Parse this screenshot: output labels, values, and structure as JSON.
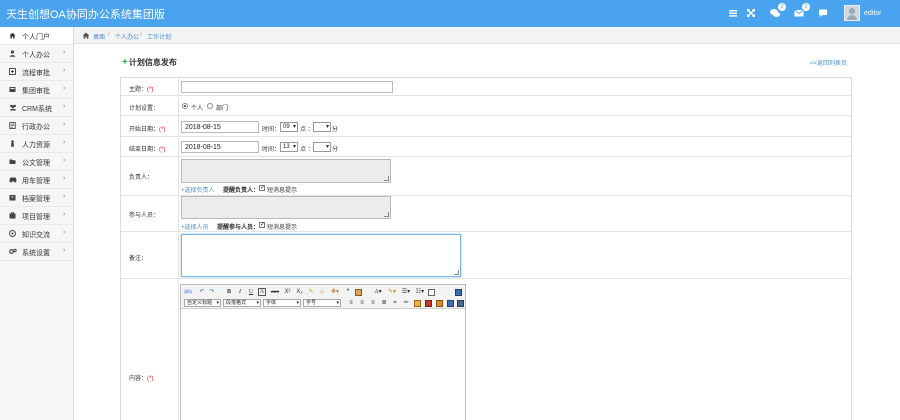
{
  "app": {
    "title": "天生创想OA协同办公系统集团版",
    "username": "editor",
    "badges": {
      "messages": "0",
      "mail": "0"
    },
    "icons": [
      "menu-icon",
      "expand-icon",
      "message-icon",
      "mail-icon",
      "chat-icon",
      "avatar"
    ]
  },
  "sidebar": {
    "items": [
      {
        "label": "个人门户",
        "icon": "home-icon",
        "active": true
      },
      {
        "label": "个人办公",
        "icon": "user-icon"
      },
      {
        "label": "流程审批",
        "icon": "flow-icon"
      },
      {
        "label": "集团审批",
        "icon": "group-icon"
      },
      {
        "label": "CRM系统",
        "icon": "users-icon"
      },
      {
        "label": "行政办公",
        "icon": "admin-icon"
      },
      {
        "label": "人力资源",
        "icon": "person-icon"
      },
      {
        "label": "公文管理",
        "icon": "folder-icon"
      },
      {
        "label": "用车管理",
        "icon": "car-icon"
      },
      {
        "label": "档案管理",
        "icon": "archive-icon"
      },
      {
        "label": "项目管理",
        "icon": "project-icon"
      },
      {
        "label": "知识交流",
        "icon": "knowledge-icon"
      },
      {
        "label": "系统设置",
        "icon": "gears-icon"
      }
    ]
  },
  "breadcrumb": {
    "home": "桌面",
    "level1": "个人办公",
    "level2": "工作计划",
    "separator": "/"
  },
  "page": {
    "title": "计划信息发布",
    "back_link": "<<返回列表页"
  },
  "form": {
    "required_mark": "(*)",
    "subject": {
      "label": "主题：",
      "value": ""
    },
    "plan_setting": {
      "label": "计划设置：",
      "options": [
        "个人",
        "部门"
      ],
      "selected": "个人"
    },
    "start_date": {
      "label": "开始日期：",
      "date": "2018-08-15",
      "time_label": "时间：",
      "hour": "09",
      "hour_unit": "点 ：",
      "minute": "",
      "minute_unit": "分"
    },
    "end_date": {
      "label": "结束日期：",
      "date": "2018-08-15",
      "time_label": "时间：",
      "hour": "13",
      "hour_unit": "点 ：",
      "minute": "",
      "minute_unit": "分"
    },
    "owner": {
      "label": "负责人：",
      "select_link": "+选择负责人",
      "remind_label": "提醒负责人：",
      "sms_label": "短消息提示",
      "sms_checked": true
    },
    "participants": {
      "label": "参与人员：",
      "select_link": "+选择人员",
      "remind_label": "提醒参与人员：",
      "sms_label": "短消息提示",
      "sms_checked": true
    },
    "remark": {
      "label": "备注："
    },
    "content": {
      "label": "内容："
    }
  },
  "editor": {
    "row1": [
      "源码",
      "撤销",
      "重做",
      "B",
      "I",
      "U",
      "A",
      "ABC",
      "X²",
      "X₂",
      "清除格式",
      "格式刷",
      "自动排版",
      "“",
      "表格",
      "A",
      "背景色",
      "有序列表",
      "无序列表",
      "插入",
      "全屏"
    ],
    "row2": {
      "custom_title": "自定义标题",
      "paragraph": "段落格式",
      "font": "字体",
      "size": "字号"
    },
    "row2_icons": [
      "justify-left-icon",
      "justify-center-icon",
      "justify-right-icon",
      "justify-full-icon",
      "link-icon",
      "unlink-icon",
      "image-icon",
      "emotion-icon",
      "video-icon",
      "map-icon",
      "attachment-icon",
      "special-icon"
    ]
  }
}
